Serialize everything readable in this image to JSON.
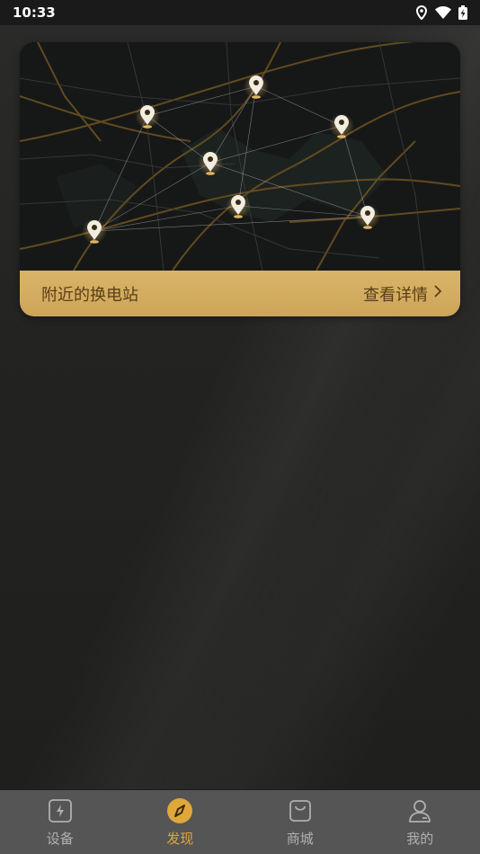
{
  "status_bar": {
    "time": "10:33",
    "icons": [
      "location-icon",
      "wifi-icon",
      "battery-charging-icon"
    ]
  },
  "station_card": {
    "title": "附近的换电站",
    "link_label": "查看详情",
    "link_icon": "chevron-right-icon",
    "accent_color": "#d4ac62",
    "map_pins": 7
  },
  "tab_bar": {
    "active_color": "#e0a83a",
    "inactive_color": "#b0b0b0",
    "tabs": [
      {
        "label": "设备",
        "icon": "device-bolt-icon",
        "active": false
      },
      {
        "label": "发现",
        "icon": "compass-icon",
        "active": true
      },
      {
        "label": "商城",
        "icon": "shopping-bag-icon",
        "active": false
      },
      {
        "label": "我的",
        "icon": "user-icon",
        "active": false
      }
    ]
  }
}
